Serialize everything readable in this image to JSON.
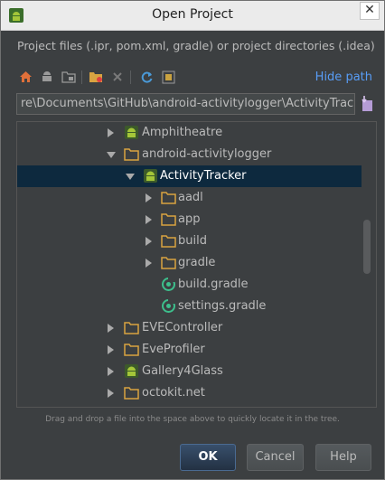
{
  "window": {
    "title": "Open Project",
    "close_label": "✕"
  },
  "description": "Project files (.ipr, pom.xml, gradle) or project directories (.idea)",
  "toolbar": {
    "buttons": [
      "home-icon",
      "desktop-icon",
      "project-folder-icon",
      "new-folder-icon",
      "delete-icon",
      "refresh-icon",
      "show-hidden-icon"
    ],
    "hide_path_label": "Hide path"
  },
  "path_field": {
    "value": "re\\Documents\\GitHub\\android-activitylogger\\ActivityTracker"
  },
  "tree": {
    "items": [
      {
        "label": "Amphitheatre",
        "icon": "android-module-icon",
        "expanded": false
      },
      {
        "label": "android-activitylogger",
        "icon": "folder-icon",
        "expanded": true
      },
      {
        "label": "ActivityTracker",
        "icon": "android-module-icon",
        "expanded": true,
        "selected": true
      },
      {
        "label": "aadl",
        "icon": "folder-icon",
        "expanded": false
      },
      {
        "label": "app",
        "icon": "folder-icon",
        "expanded": false
      },
      {
        "label": "build",
        "icon": "folder-icon",
        "expanded": false
      },
      {
        "label": "gradle",
        "icon": "folder-icon",
        "expanded": false
      },
      {
        "label": "build.gradle",
        "icon": "gradle-file-icon"
      },
      {
        "label": "settings.gradle",
        "icon": "gradle-file-icon"
      },
      {
        "label": "EVEController",
        "icon": "folder-icon",
        "expanded": false
      },
      {
        "label": "EveProfiler",
        "icon": "folder-icon",
        "expanded": false
      },
      {
        "label": "Gallery4Glass",
        "icon": "android-module-icon",
        "expanded": false
      },
      {
        "label": "octokit.net",
        "icon": "folder-icon",
        "expanded": false
      }
    ]
  },
  "hint": "Drag and drop a file into the space above to quickly locate it in the tree.",
  "buttons": {
    "ok": "OK",
    "cancel": "Cancel",
    "help": "Help"
  },
  "colors": {
    "accent": "#589df6",
    "selection": "#0d293e",
    "folder": "#d9a441",
    "android": "#a4c639",
    "gradle": "#3dbf8c"
  }
}
